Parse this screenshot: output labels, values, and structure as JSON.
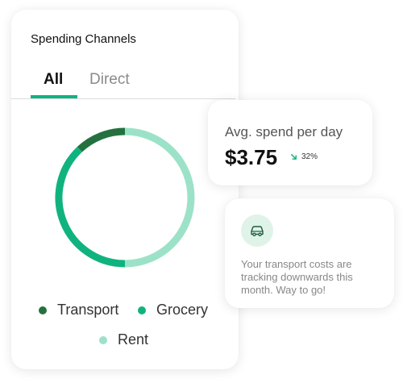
{
  "spending_card": {
    "title": "Spending Channels",
    "tabs": [
      {
        "label": "All",
        "active": true
      },
      {
        "label": "Direct",
        "active": false
      }
    ],
    "segments": [
      {
        "name": "Transport",
        "color": "#24713f",
        "fraction": 0.12
      },
      {
        "name": "Grocery",
        "color": "#10b37f",
        "fraction": 0.38
      },
      {
        "name": "Rent",
        "color": "#9be2c9",
        "fraction": 0.5
      }
    ],
    "legend": [
      "Transport",
      "Grocery",
      "Rent"
    ]
  },
  "avg_card": {
    "label": "Avg. spend per day",
    "value": "$3.75",
    "change": "32%",
    "change_icon": "arrow-down-right-icon",
    "change_color": "#10b37f"
  },
  "tip_card": {
    "icon": "car-icon",
    "message": "Your transport costs are tracking downwards this month. Way to go!"
  },
  "accent_color": "#10b37f"
}
